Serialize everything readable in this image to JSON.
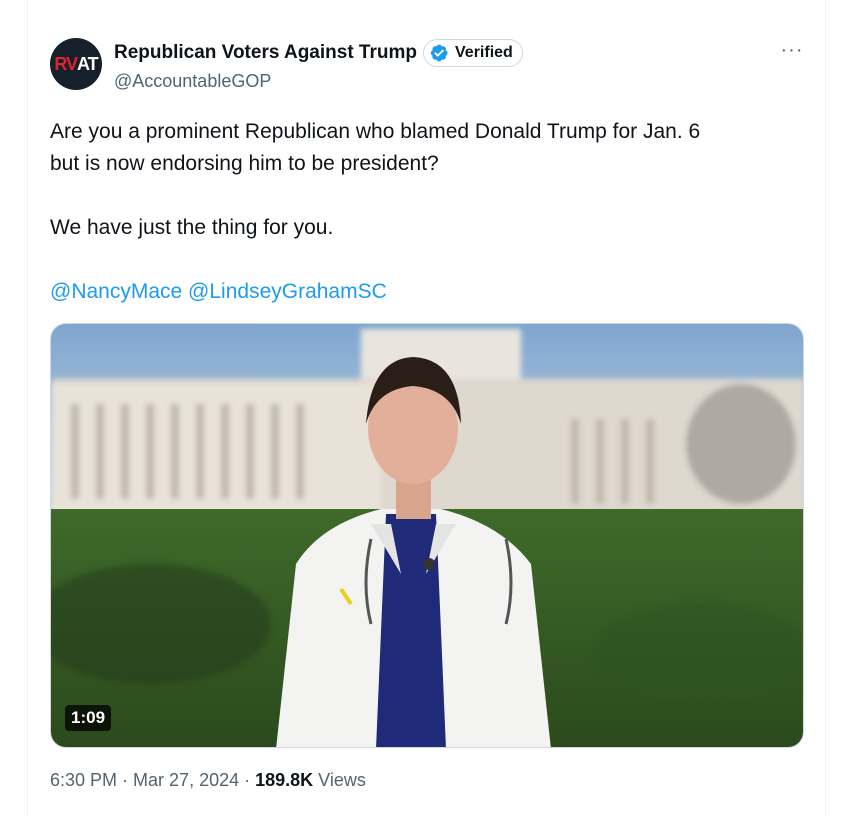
{
  "author": {
    "avatar_text_red": "RV",
    "avatar_text_white": "AT",
    "display_name": "Republican Voters Against Trump",
    "verified_label": "Verified",
    "handle": "@AccountableGOP"
  },
  "menu": {
    "more_label": "···"
  },
  "tweet": {
    "line1": "Are you a prominent Republican who blamed Donald Trump for Jan. 6",
    "line2": "but is now endorsing him to be president?",
    "line3": "We have just the thing for you.",
    "mentions": [
      "@NancyMace",
      "@LindseyGrahamSC"
    ]
  },
  "media": {
    "duration": "1:09"
  },
  "meta": {
    "time": "6:30 PM",
    "sep1": "·",
    "date": "Mar 27, 2024",
    "sep2": "·",
    "views_count": "189.8K",
    "views_label": "Views"
  },
  "colors": {
    "link": "#1d9bf0",
    "verified_badge": "#1d9bf0",
    "secondary_text": "#536471",
    "avatar_bg": "#15202b",
    "avatar_red": "#e0242f"
  }
}
